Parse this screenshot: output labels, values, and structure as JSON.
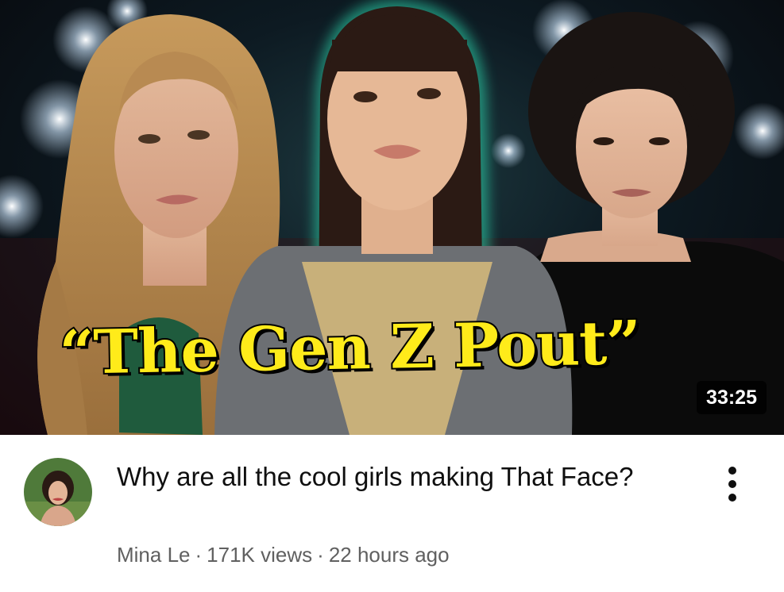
{
  "video": {
    "thumbnail_text": "“The Gen Z Pout”",
    "duration": "33:25",
    "title": "Why are all the cool girls making That Face?",
    "channel": "Mina Le",
    "views": "171K views",
    "age": "22 hours ago",
    "separator": "·"
  },
  "icons": {
    "more": "more-vert-icon",
    "avatar": "channel-avatar"
  },
  "colors": {
    "thumbnail_text": "#ffeb1a",
    "glow": "#2ee6b8",
    "meta_text": "#606060",
    "title_text": "#0f0f0f"
  }
}
